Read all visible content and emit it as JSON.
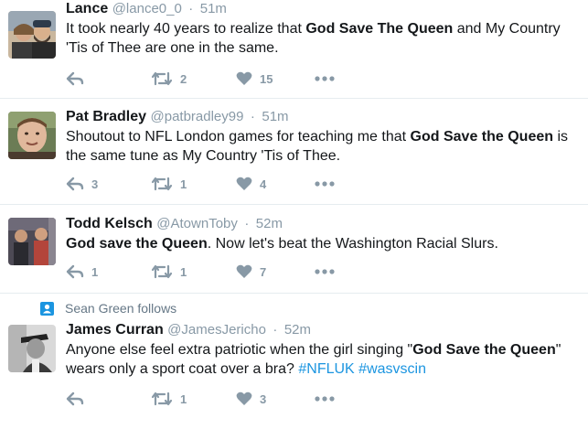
{
  "tweets": [
    {
      "fullname": "Lance",
      "username": "@lance0_0",
      "sep": "·",
      "time": "51m",
      "text_parts": [
        "It took nearly 40 years to realize that ",
        "God Save The Queen",
        " and My Country 'Tis of Thee are one in the same."
      ],
      "reply_count": "",
      "retweet_count": "2",
      "like_count": "15",
      "avatar_colors": [
        "#8a7358",
        "#c9b79e",
        "#3a3a3a"
      ]
    },
    {
      "fullname": "Pat Bradley",
      "username": "@patbradley99",
      "sep": "·",
      "time": "51m",
      "text_parts": [
        "Shoutout to NFL London games for teaching me that ",
        "God Save the Queen",
        " is the same tune as My Country 'Tis of Thee."
      ],
      "reply_count": "3",
      "retweet_count": "1",
      "like_count": "4",
      "avatar_colors": [
        "#d8b49a",
        "#6b7c55",
        "#4a3a2e"
      ]
    },
    {
      "fullname": "Todd Kelsch",
      "username": "@AtownToby",
      "sep": "·",
      "time": "52m",
      "text_parts": [
        "God save the Queen",
        ". Now let's beat the Washington Racial Slurs."
      ],
      "reply_count": "1",
      "retweet_count": "1",
      "like_count": "7",
      "avatar_colors": [
        "#4d4a55",
        "#b3453b",
        "#2a2a30"
      ]
    },
    {
      "context": "Sean Green follows",
      "fullname": "James Curran",
      "username": "@JamesJericho",
      "sep": "·",
      "time": "52m",
      "text_parts": [
        "Anyone else feel extra patriotic when the girl singing \"",
        "God Save the Queen",
        "\" wears only a sport coat over a bra? "
      ],
      "hashtags": [
        "#NFLUK",
        "#wasvscin"
      ],
      "reply_count": "",
      "retweet_count": "1",
      "like_count": "3",
      "avatar_colors": [
        "#5a5a5a",
        "#d9d9d9",
        "#222222"
      ]
    }
  ],
  "icons": {
    "reply": "reply-icon",
    "retweet": "retweet-icon",
    "like": "heart-icon",
    "more": "more-icon",
    "follow_context": "person-icon"
  },
  "colors": {
    "icon_gray": "#8899a6",
    "link_blue": "#1b95e0",
    "divider": "#e6ecf0"
  }
}
